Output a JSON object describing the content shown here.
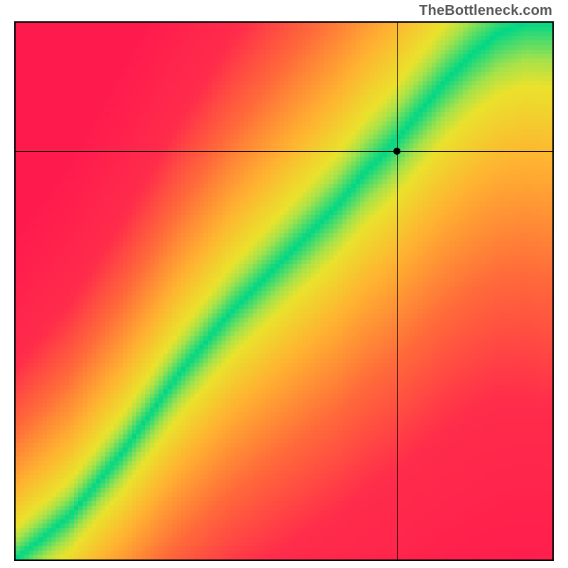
{
  "watermark": "TheBottleneck.com",
  "chart_data": {
    "type": "heatmap",
    "title": "",
    "xlabel": "",
    "ylabel": "",
    "xlim": [
      0,
      100
    ],
    "ylim": [
      0,
      100
    ],
    "crosshair": {
      "x": 71,
      "y": 76
    },
    "ridge": {
      "description": "Optimal-balance green ridge; points below are CPU-limited (red bottom-right), points above are GPU-limited (red top-left).",
      "points_xy": [
        [
          0,
          0
        ],
        [
          10,
          8
        ],
        [
          20,
          20
        ],
        [
          30,
          34
        ],
        [
          40,
          46
        ],
        [
          50,
          56
        ],
        [
          60,
          66
        ],
        [
          65,
          72
        ],
        [
          70,
          77
        ],
        [
          75,
          83
        ],
        [
          80,
          89
        ],
        [
          85,
          94
        ],
        [
          90,
          98
        ],
        [
          95,
          100
        ],
        [
          100,
          100
        ]
      ]
    },
    "color_stops": [
      {
        "distance": 0,
        "color": "#00d786"
      },
      {
        "distance": 6,
        "color": "#a7e24a"
      },
      {
        "distance": 10,
        "color": "#eae22c"
      },
      {
        "distance": 22,
        "color": "#ffb231"
      },
      {
        "distance": 40,
        "color": "#ff6a3a"
      },
      {
        "distance": 60,
        "color": "#ff2c4a"
      },
      {
        "distance": 100,
        "color": "#ff1a4e"
      }
    ],
    "grid": false,
    "legend": "none"
  }
}
